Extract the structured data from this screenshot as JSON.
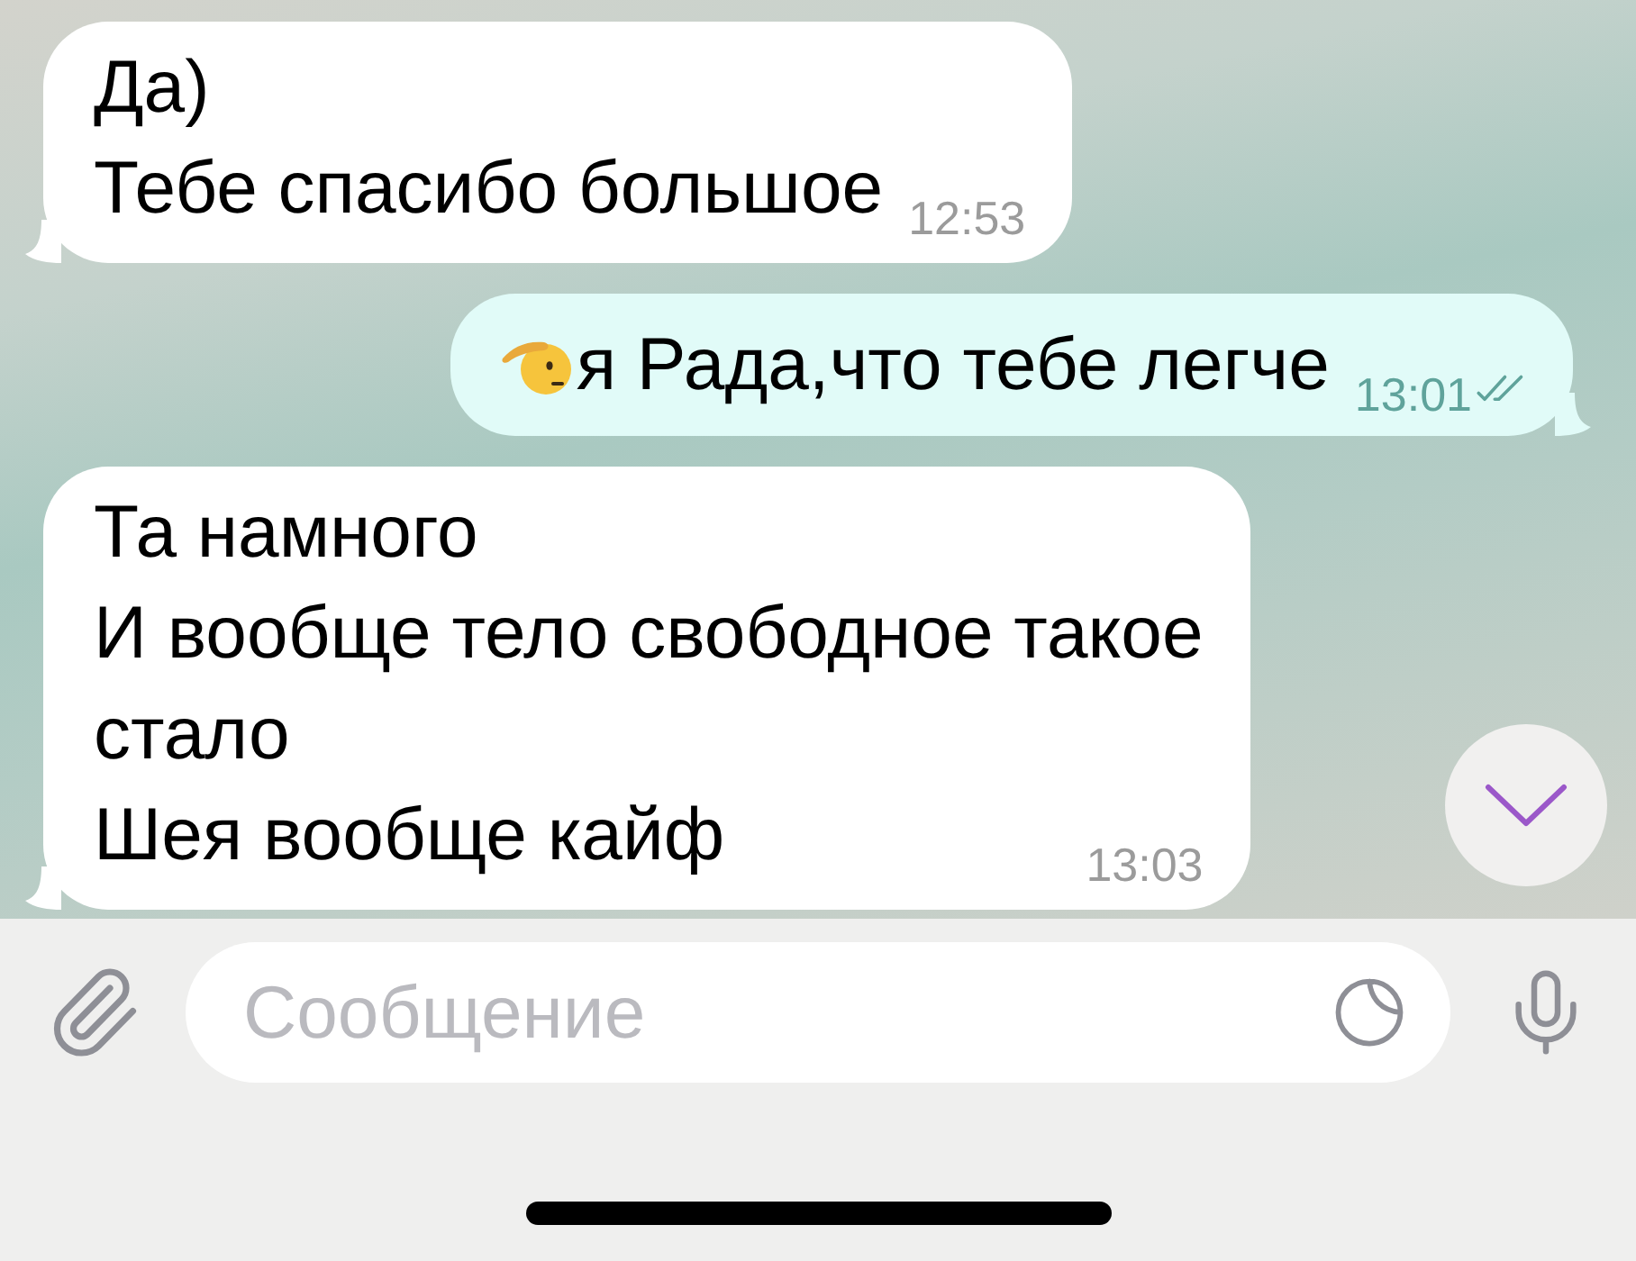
{
  "messages": [
    {
      "kind": "incoming",
      "lines": [
        "Да)",
        "Тебе спасибо большое"
      ],
      "time": "12:53"
    },
    {
      "kind": "outgoing",
      "emoji": true,
      "lines": [
        "я Рада,что тебе легче"
      ],
      "time": "13:01",
      "read": true
    },
    {
      "kind": "incoming",
      "lines": [
        "Та намного",
        "И вообще тело свободное такое",
        "стало",
        "Шея вообще кайф"
      ],
      "time": "13:03"
    }
  ],
  "composer": {
    "placeholder": "Сообщение"
  }
}
